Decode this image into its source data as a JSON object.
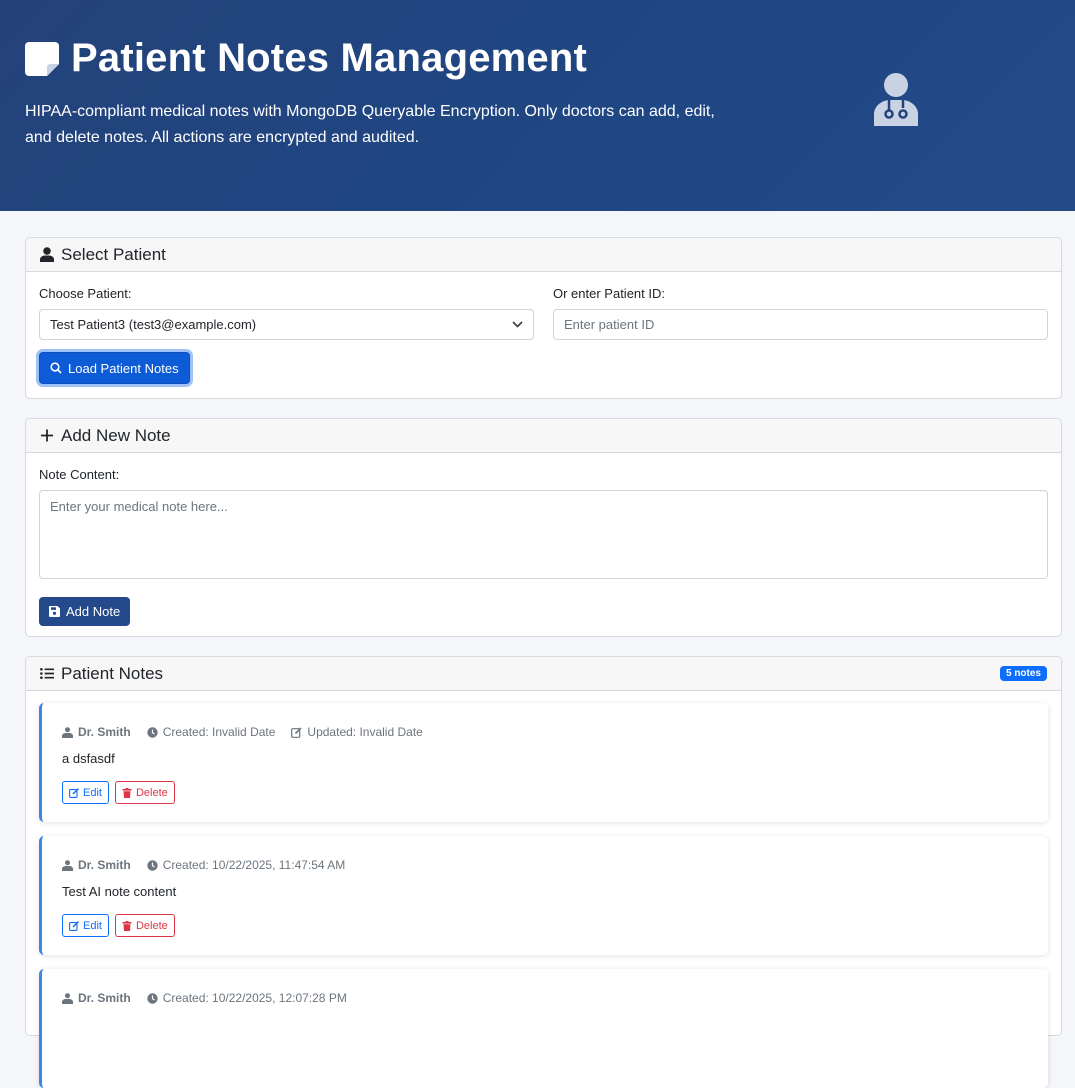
{
  "header": {
    "title": "Patient Notes Management",
    "subtitle": "HIPAA-compliant medical notes with MongoDB Queryable Encryption. Only doctors can add, edit, and delete notes. All actions are encrypted and audited.",
    "title_icon": "sticky-note-icon",
    "side_icon": "user-doctor-icon"
  },
  "select_patient": {
    "heading": "Select Patient",
    "choose_label": "Choose Patient:",
    "selected_patient": "Test Patient3 (test3@example.com)",
    "id_label": "Or enter Patient ID:",
    "id_placeholder": "Enter patient ID",
    "load_button": "Load Patient Notes"
  },
  "add_note": {
    "heading": "Add New Note",
    "content_label": "Note Content:",
    "content_placeholder": "Enter your medical note here...",
    "add_button": "Add Note"
  },
  "notes": {
    "heading": "Patient Notes",
    "count_badge": "5 notes",
    "edit_label": "Edit",
    "delete_label": "Delete",
    "items": [
      {
        "author": "Dr. Smith",
        "created": "Created: Invalid Date",
        "updated": "Updated: Invalid Date",
        "text": "a dsfasdf"
      },
      {
        "author": "Dr. Smith",
        "created": "Created: 10/22/2025, 11:47:54 AM",
        "updated": "",
        "text": "Test AI note content"
      },
      {
        "author": "Dr. Smith",
        "created": "Created: 10/22/2025, 12:07:28 PM",
        "updated": "",
        "text": ""
      }
    ]
  },
  "colors": {
    "header_bg": "#24427a",
    "primary": "#0d5bd6",
    "add_button": "#244a8c",
    "edit": "#0d6efd",
    "delete": "#dc3545",
    "note_accent": "#3d86e8"
  }
}
